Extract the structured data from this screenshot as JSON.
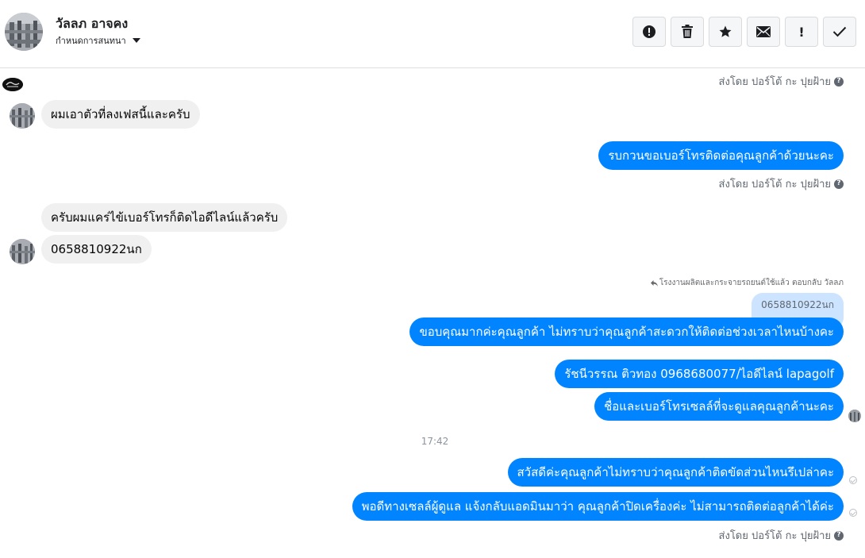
{
  "header": {
    "contact_name": "วัลลภ อาจคง",
    "conversation_label": "กำหนดการสนทนา",
    "toolbar": {
      "buttons": [
        {
          "name": "alert-button",
          "icon": "alert-circle-icon"
        },
        {
          "name": "delete-button",
          "icon": "trash-icon"
        },
        {
          "name": "star-button",
          "icon": "star-icon"
        },
        {
          "name": "mark-unread-button",
          "icon": "envelope-icon"
        },
        {
          "name": "important-button",
          "icon": "exclamation-icon",
          "glyph": "!"
        },
        {
          "name": "done-button",
          "icon": "check-icon"
        }
      ]
    }
  },
  "thread": {
    "sent_by_label": "ส่งโดย ปอร์โต้ กะ ปุยฝ้าย",
    "help_glyph": "?",
    "messages": [
      {
        "direction": "in",
        "text": "ผมเอาตัวที่ลงเฟสนี้และครับ"
      },
      {
        "direction": "out",
        "text": "รบกวนขอเบอร์โทรติดต่อคุณลูกค้าด้วยนะคะ"
      },
      {
        "direction": "in",
        "text": "ครับผมแคร่ไข้เบอร์โทรก็ติดไอดีไลน์แล้วครับ"
      },
      {
        "direction": "in",
        "text": "0658810922นก"
      },
      {
        "direction": "out",
        "text": "ขอบคุณมากค่ะคุณลูกค้า ไม่ทราบว่าคุณลูกค้าสะดวกให้ติดต่อช่วงเวลาไหนบ้างคะ"
      },
      {
        "direction": "out",
        "text": "รัชนีวรรณ ติวทอง    0968680077/ไอดีไลน์ lapagolf"
      },
      {
        "direction": "out",
        "text": "ชื่อและเบอร์โทรเซลล์ที่จะดูแลคุณลูกค้านะคะ"
      },
      {
        "direction": "out",
        "text": "สวัสดีค่ะคุณลูกค้าไม่ทราบว่าคุณลูกค้าติดขัดส่วนไหนรึเปล่าคะ"
      },
      {
        "direction": "out",
        "text": "พอดีทางเซลล์ผู้ดูแล แจ้งกลับแอดมินมาว่า คุณลูกค้าปิดเครื่องค่ะ ไม่สามารถติดต่อลูกค้าได้ค่ะ"
      }
    ],
    "reply_note": "โรงงานผลิตและกระจายรถยนต์ใช้แล้ว ตอบกลับ วัลลภ",
    "quoted_text": "0658810922นก",
    "time_separator": "17:42"
  },
  "colors": {
    "outgoing_bubble": "#0084ff",
    "incoming_bubble": "#f0f0f0",
    "quote_bubble": "#cce4ff"
  }
}
